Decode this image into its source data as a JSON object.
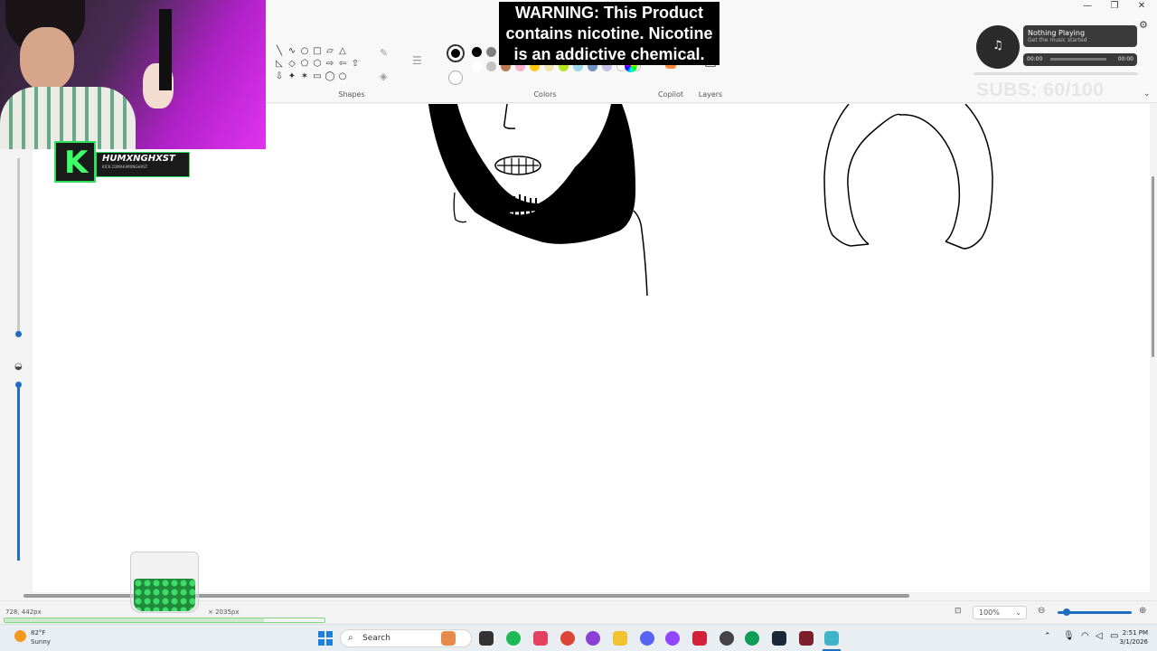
{
  "ribbon": {
    "shapes_label": "Shapes",
    "colors_label": "Colors",
    "copilot_label": "Copilot",
    "layers_label": "Layers",
    "palette_row1": [
      "#000000",
      "#7f7f7f",
      "#880015",
      "#ed1c24",
      "#ff7f27",
      "#fff200",
      "#22b14c",
      "#00a2e8",
      "#3f48cc",
      "#a349a4"
    ],
    "palette_row2": [
      "#ffffff",
      "#c3c3c3",
      "#b97a57",
      "#ffaec9",
      "#ffc90e",
      "#efe4b0",
      "#b5e61d",
      "#99d9ea",
      "#7092be",
      "#c8bfe7"
    ],
    "shape_glyphs": [
      "╲",
      "∿",
      "○",
      "□",
      "▱",
      "△",
      "",
      "◺",
      "◇",
      "⬠",
      "⬡",
      "⇨",
      "⇦",
      "⇧",
      "⇩",
      "✦",
      "✶",
      "▭",
      "◯",
      "○",
      ""
    ]
  },
  "overlay": {
    "warning_text": "WARNING: This Product contains nicotine. Nicotine is an addictive chemical.",
    "music_title": "Nothing Playing",
    "music_subtitle": "Get the music started",
    "music_time_start": "00:00",
    "music_time_end": "00:00",
    "subs_text": "SUBS: 60/100",
    "streamer_name": "HUMXNGHXST",
    "streamer_url": "KICK.COM/HUMXNGHXST"
  },
  "status": {
    "cursor_pos": "728, 442px",
    "canvas_size": "× 2035px",
    "zoom": "100%"
  },
  "taskbar": {
    "temperature": "82°F",
    "weather": "Sunny",
    "search_label": "Search",
    "time": "2:51 PM",
    "date": "3/1/2026"
  },
  "colors": {
    "accent": "#1e6fc2",
    "ink": "#000000"
  }
}
